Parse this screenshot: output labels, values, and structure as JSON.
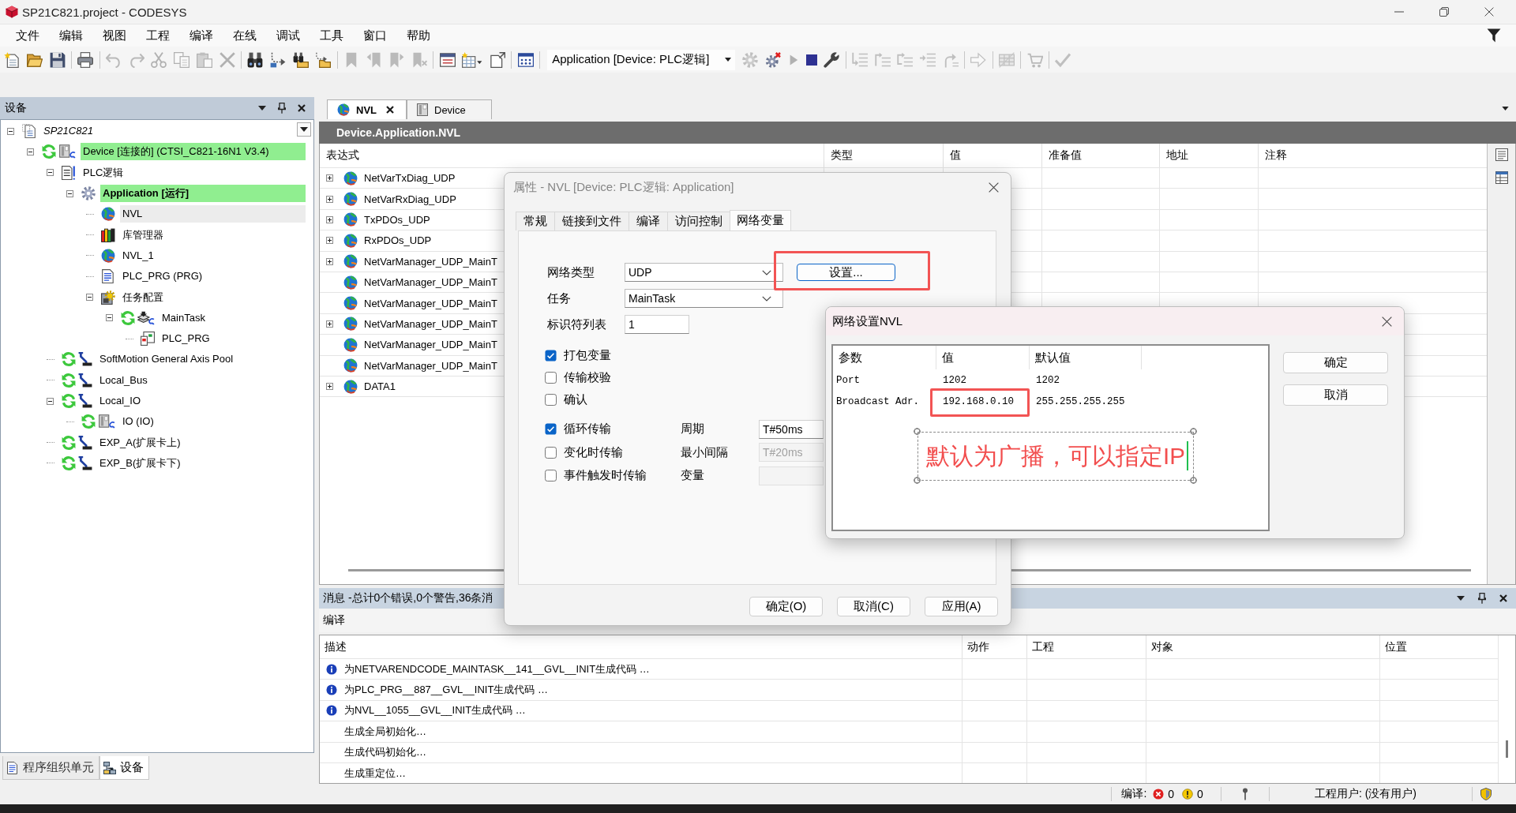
{
  "window": {
    "title": "SP21C821.project - CODESYS"
  },
  "menu": [
    "文件",
    "编辑",
    "视图",
    "工程",
    "编译",
    "在线",
    "调试",
    "工具",
    "窗口",
    "帮助"
  ],
  "toolbar": {
    "items": [
      {
        "kind": "button",
        "disabled": false
      },
      {
        "kind": "button",
        "disabled": false
      },
      {
        "kind": "button",
        "disabled": false
      },
      {
        "kind": "separator"
      },
      {
        "kind": "button",
        "disabled": false
      },
      {
        "kind": "separator"
      },
      {
        "kind": "button",
        "disabled": true
      },
      {
        "kind": "button",
        "disabled": true
      },
      {
        "kind": "button",
        "disabled": true
      },
      {
        "kind": "button",
        "disabled": true
      },
      {
        "kind": "button",
        "disabled": true
      },
      {
        "kind": "button",
        "disabled": true
      },
      {
        "kind": "separator"
      },
      {
        "kind": "button",
        "disabled": false
      },
      {
        "kind": "button",
        "disabled": false
      },
      {
        "kind": "button",
        "disabled": false
      },
      {
        "kind": "button",
        "disabled": false
      },
      {
        "kind": "separator"
      },
      {
        "kind": "button",
        "disabled": true
      },
      {
        "kind": "button",
        "disabled": true
      },
      {
        "kind": "button",
        "disabled": true
      },
      {
        "kind": "button",
        "disabled": true
      },
      {
        "kind": "separator"
      },
      {
        "kind": "button",
        "disabled": false
      },
      {
        "kind": "button",
        "disabled": false
      },
      {
        "kind": "button",
        "disabled": false
      },
      {
        "kind": "separator"
      },
      {
        "kind": "button",
        "disabled": false
      },
      {
        "kind": "separator"
      },
      {
        "kind": "selector",
        "value": "Application [Device: PLC逻辑]"
      },
      {
        "kind": "button",
        "disabled": true
      },
      {
        "kind": "button",
        "disabled": false
      },
      {
        "kind": "button",
        "disabled": true
      },
      {
        "kind": "button",
        "disabled": false
      },
      {
        "kind": "button",
        "disabled": false
      },
      {
        "kind": "separator"
      },
      {
        "kind": "button",
        "disabled": true
      },
      {
        "kind": "button",
        "disabled": true
      },
      {
        "kind": "button",
        "disabled": true
      },
      {
        "kind": "button",
        "disabled": true
      },
      {
        "kind": "button",
        "disabled": true
      },
      {
        "kind": "separator"
      },
      {
        "kind": "button",
        "disabled": true
      },
      {
        "kind": "separator"
      },
      {
        "kind": "button",
        "disabled": true
      },
      {
        "kind": "separator"
      },
      {
        "kind": "button",
        "disabled": true
      },
      {
        "kind": "separator"
      },
      {
        "kind": "button",
        "disabled": true
      }
    ]
  },
  "devices_panel": {
    "title": "设备",
    "tree": [
      {
        "label": "SP21C821",
        "kind": "project",
        "online": false,
        "highlighted": false,
        "selected": false,
        "expanded": true,
        "children": [
          {
            "label": "Device [连接的] (CTSI_C821-16N1 V3.4)",
            "kind": "device",
            "online": true,
            "highlighted": true,
            "selected": false,
            "expanded": true,
            "children": [
              {
                "label": "PLC逻辑",
                "kind": "logic",
                "online": false,
                "highlighted": false,
                "selected": false,
                "expanded": true,
                "children": [
                  {
                    "label": "Application [运行]",
                    "kind": "application",
                    "online": false,
                    "highlighted": true,
                    "selected": false,
                    "expanded": true,
                    "children": [
                      {
                        "label": "NVL",
                        "kind": "nvl",
                        "online": false,
                        "highlighted": false,
                        "selected": true
                      },
                      {
                        "label": "库管理器",
                        "kind": "library",
                        "online": false,
                        "highlighted": false,
                        "selected": false
                      },
                      {
                        "label": "NVL_1",
                        "kind": "nvl",
                        "online": false,
                        "highlighted": false,
                        "selected": false
                      },
                      {
                        "label": "PLC_PRG (PRG)",
                        "kind": "program",
                        "online": false,
                        "highlighted": false,
                        "selected": false
                      },
                      {
                        "label": "任务配置",
                        "kind": "task-config",
                        "online": false,
                        "highlighted": false,
                        "selected": false,
                        "expanded": true,
                        "children": [
                          {
                            "label": "MainTask",
                            "kind": "task",
                            "online": true,
                            "highlighted": false,
                            "selected": false,
                            "expanded": true,
                            "children": [
                              {
                                "label": "PLC_PRG",
                                "kind": "call",
                                "online": false,
                                "highlighted": false,
                                "selected": false
                              }
                            ]
                          }
                        ]
                      }
                    ]
                  }
                ]
              },
              {
                "label": "SoftMotion General Axis Pool",
                "kind": "bus",
                "online": true,
                "highlighted": false,
                "selected": false
              },
              {
                "label": "Local_Bus",
                "kind": "bus",
                "online": true,
                "highlighted": false,
                "selected": false
              },
              {
                "label": "Local_IO",
                "kind": "bus",
                "online": true,
                "highlighted": false,
                "selected": false,
                "expanded": true,
                "children": [
                  {
                    "label": "IO (IO)",
                    "kind": "device",
                    "online": true,
                    "highlighted": false,
                    "selected": false
                  }
                ]
              },
              {
                "label": "EXP_A(扩展卡上)",
                "kind": "bus",
                "online": true,
                "highlighted": false,
                "selected": false
              },
              {
                "label": "EXP_B(扩展卡下)",
                "kind": "bus",
                "online": true,
                "highlighted": false,
                "selected": false
              }
            ]
          }
        ]
      }
    ],
    "bottom_tabs": [
      {
        "label": "程序组织单元",
        "selected": false
      },
      {
        "label": "设备",
        "selected": true
      }
    ]
  },
  "editor": {
    "tabs": [
      {
        "label": "NVL",
        "selected": true
      },
      {
        "label": "Device",
        "selected": false
      }
    ],
    "path": "Device.Application.NVL",
    "columns": [
      "表达式",
      "类型",
      "值",
      "准备值",
      "地址",
      "注释"
    ],
    "rows": [
      {
        "expression": "NetVarTxDiag_UDP",
        "expanded": false
      },
      {
        "expression": "NetVarRxDiag_UDP",
        "expanded": false
      },
      {
        "expression": "TxPDOs_UDP",
        "expanded": false
      },
      {
        "expression": "RxPDOs_UDP",
        "expanded": false
      },
      {
        "expression": "NetVarManager_UDP_MainT",
        "expanded": false
      },
      {
        "expression": "NetVarManager_UDP_MainT"
      },
      {
        "expression": "NetVarManager_UDP_MainT"
      },
      {
        "expression": "NetVarManager_UDP_MainT",
        "expanded": false
      },
      {
        "expression": "NetVarManager_UDP_MainT"
      },
      {
        "expression": "NetVarManager_UDP_MainT"
      },
      {
        "expression": "DATA1",
        "expanded": false
      }
    ]
  },
  "messages": {
    "title": "消息 -总计0个错误,0个警告,36条消",
    "category": "编译",
    "columns": [
      "描述",
      "动作",
      "工程",
      "对象",
      "位置"
    ],
    "rows": [
      {
        "kind": "info",
        "description": "为NETVARENDCODE_MAINTASK__141__GVL__INIT生成代码 …"
      },
      {
        "kind": "info",
        "description": "为PLC_PRG__887__GVL__INIT生成代码 …"
      },
      {
        "kind": "info",
        "description": "为NVL__1055__GVL__INIT生成代码 …"
      },
      {
        "kind": "detail",
        "description": "生成全局初始化…"
      },
      {
        "kind": "detail",
        "description": "生成代码初始化…"
      },
      {
        "kind": "detail",
        "description": "生成重定位…"
      }
    ]
  },
  "status_bar": {
    "build_label": "编译:",
    "errors": "0",
    "warnings": "0",
    "user": "工程用户: (没有用户)"
  },
  "properties_dialog": {
    "title": "属性 - NVL [Device: PLC逻辑: Application]",
    "tabs": [
      {
        "label": "常规",
        "selected": false
      },
      {
        "label": "链接到文件",
        "selected": false
      },
      {
        "label": "编译",
        "selected": false
      },
      {
        "label": "访问控制",
        "selected": false
      },
      {
        "label": "网络变量",
        "selected": true
      }
    ],
    "network_type": {
      "label": "网络类型",
      "value": "UDP"
    },
    "settings_button": {
      "label": "设置...",
      "highlighted": true
    },
    "task": {
      "label": "任务",
      "value": "MainTask"
    },
    "identifier": {
      "label": "标识符列表",
      "value": "1"
    },
    "options": [
      {
        "label": "打包变量",
        "checked": true
      },
      {
        "label": "传输校验",
        "checked": false
      },
      {
        "label": "确认",
        "checked": false
      }
    ],
    "transmission": [
      {
        "label": "循环传输",
        "checked": true,
        "field_label": "周期",
        "value": "T#50ms",
        "disabled": false
      },
      {
        "label": "变化时传输",
        "checked": false,
        "field_label": "最小间隔",
        "value": "T#20ms",
        "disabled": true
      },
      {
        "label": "事件触发时传输",
        "checked": false,
        "field_label": "变量",
        "disabled": true
      }
    ],
    "buttons": [
      "确定(O)",
      "取消(C)",
      "应用(A)"
    ]
  },
  "network_dialog": {
    "title": "网络设置NVL",
    "columns": [
      "参数",
      "值",
      "默认值"
    ],
    "rows": [
      {
        "parameter": "Port",
        "value": "1202",
        "default": "1202",
        "highlighted": false
      },
      {
        "parameter": "Broadcast Adr.",
        "value": "192.168.0.10",
        "default": "255.255.255.255",
        "highlighted": true
      }
    ],
    "annotation": "默认为广播，可以指定IP",
    "buttons": [
      "确定",
      "取消"
    ]
  }
}
